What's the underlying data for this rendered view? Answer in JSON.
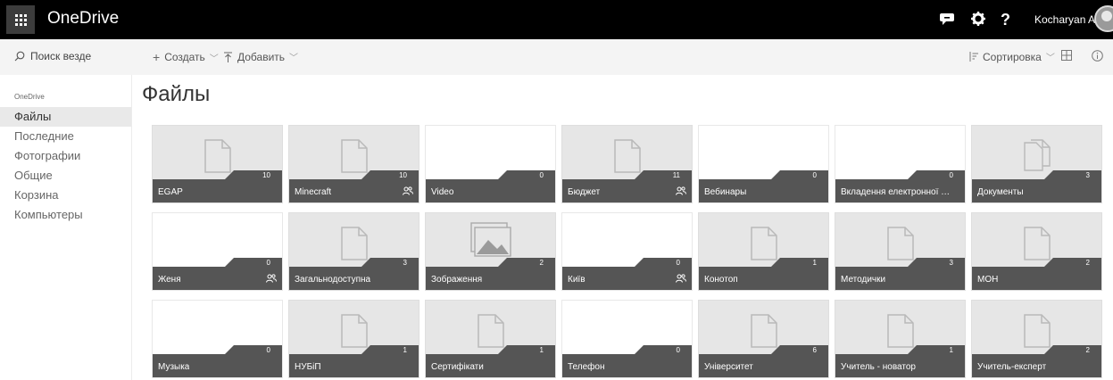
{
  "suitebar": {
    "app_name": "OneDrive",
    "user_name": "Kocharyan Artur",
    "icons": [
      "app-launcher-icon",
      "feedback-icon",
      "settings-icon",
      "help-icon"
    ],
    "help_glyph": "?"
  },
  "commandbar": {
    "search_placeholder": "Поиск везде",
    "create_label": "Создать",
    "upload_label": "Добавить",
    "sort_label": "Сортировка"
  },
  "nav": {
    "heading": "OneDrive",
    "items": [
      {
        "label": "Файлы",
        "selected": true
      },
      {
        "label": "Последние",
        "selected": false
      },
      {
        "label": "Фотографии",
        "selected": false
      },
      {
        "label": "Общие",
        "selected": false
      },
      {
        "label": "Корзина",
        "selected": false
      },
      {
        "label": "Компьютеры",
        "selected": false
      }
    ]
  },
  "main": {
    "title": "Файлы",
    "folders": [
      {
        "name": "EGAP",
        "count": "10",
        "thumb": "doc",
        "shared": false
      },
      {
        "name": "Minecraft",
        "count": "10",
        "thumb": "doc",
        "shared": true
      },
      {
        "name": "Video",
        "count": "0",
        "thumb": "none",
        "shared": false
      },
      {
        "name": "Бюджет",
        "count": "11",
        "thumb": "doc",
        "shared": true
      },
      {
        "name": "Вебинары",
        "count": "0",
        "thumb": "none",
        "shared": false
      },
      {
        "name": "Вкладення електронної по...",
        "count": "0",
        "thumb": "none",
        "shared": false
      },
      {
        "name": "Документы",
        "count": "3",
        "thumb": "doc-stack",
        "shared": false
      },
      {
        "name": "Женя",
        "count": "0",
        "thumb": "none",
        "shared": true
      },
      {
        "name": "Загальнодоступна",
        "count": "3",
        "thumb": "doc",
        "shared": false
      },
      {
        "name": "Зображення",
        "count": "2",
        "thumb": "image",
        "shared": false
      },
      {
        "name": "Київ",
        "count": "0",
        "thumb": "none",
        "shared": true
      },
      {
        "name": "Конотоп",
        "count": "1",
        "thumb": "doc",
        "shared": false
      },
      {
        "name": "Методички",
        "count": "3",
        "thumb": "doc",
        "shared": false
      },
      {
        "name": "МОН",
        "count": "2",
        "thumb": "doc",
        "shared": false
      },
      {
        "name": "Музыка",
        "count": "0",
        "thumb": "none",
        "shared": false
      },
      {
        "name": "НУБіП",
        "count": "1",
        "thumb": "doc",
        "shared": false
      },
      {
        "name": "Сертифікати",
        "count": "1",
        "thumb": "doc",
        "shared": false
      },
      {
        "name": "Телефон",
        "count": "0",
        "thumb": "none",
        "shared": false
      },
      {
        "name": "Університет",
        "count": "6",
        "thumb": "doc",
        "shared": false
      },
      {
        "name": "Учитель - новатор",
        "count": "1",
        "thumb": "doc",
        "shared": false
      },
      {
        "name": "Учитель-експерт",
        "count": "2",
        "thumb": "doc",
        "shared": false
      }
    ]
  }
}
